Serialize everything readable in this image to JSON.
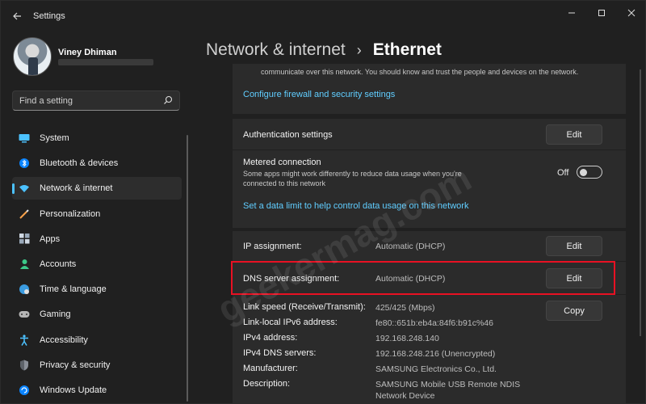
{
  "app": {
    "title": "Settings"
  },
  "user": {
    "name": "Viney Dhiman"
  },
  "search": {
    "placeholder": "Find a setting"
  },
  "nav": {
    "items": [
      {
        "label": "System",
        "icon": "system-icon"
      },
      {
        "label": "Bluetooth & devices",
        "icon": "bluetooth-icon"
      },
      {
        "label": "Network & internet",
        "icon": "network-icon",
        "active": true
      },
      {
        "label": "Personalization",
        "icon": "personalization-icon"
      },
      {
        "label": "Apps",
        "icon": "apps-icon"
      },
      {
        "label": "Accounts",
        "icon": "accounts-icon"
      },
      {
        "label": "Time & language",
        "icon": "time-language-icon"
      },
      {
        "label": "Gaming",
        "icon": "gaming-icon"
      },
      {
        "label": "Accessibility",
        "icon": "accessibility-icon"
      },
      {
        "label": "Privacy & security",
        "icon": "privacy-icon"
      },
      {
        "label": "Windows Update",
        "icon": "windows-update-icon"
      }
    ]
  },
  "header": {
    "parent": "Network & internet",
    "separator": "›",
    "current": "Ethernet"
  },
  "content": {
    "top_text": "communicate over this network. You should know and trust the people and devices on the network.",
    "firewall_link": "Configure firewall and security settings",
    "auth": {
      "label": "Authentication settings",
      "button": "Edit"
    },
    "metered": {
      "label": "Metered connection",
      "description_line1": "Some apps might work differently to reduce data usage when you're",
      "description_line2": "connected to this network",
      "toggle_state": "Off",
      "data_limit_link": "Set a data limit to help control data usage on this network"
    },
    "ip": {
      "label": "IP assignment:",
      "value": "Automatic (DHCP)",
      "button": "Edit"
    },
    "dns": {
      "label": "DNS server assignment:",
      "value": "Automatic (DHCP)",
      "button": "Edit"
    },
    "details": {
      "copy_button": "Copy",
      "rows": [
        {
          "label": "Link speed (Receive/Transmit):",
          "value": "425/425 (Mbps)"
        },
        {
          "label": "Link-local IPv6 address:",
          "value": "fe80::651b:eb4a:84f6:b91c%46"
        },
        {
          "label": "IPv4 address:",
          "value": "192.168.248.140"
        },
        {
          "label": "IPv4 DNS servers:",
          "value": "192.168.248.216 (Unencrypted)"
        },
        {
          "label": "Manufacturer:",
          "value": "SAMSUNG Electronics Co., Ltd."
        },
        {
          "label": "Description:",
          "value": "SAMSUNG Mobile USB Remote NDIS"
        },
        {
          "label": "",
          "value": "Network Device"
        }
      ]
    }
  },
  "watermark": "geekermag.com",
  "colors": {
    "background": "#202020",
    "panel": "#2b2b2b",
    "link": "#60cdff",
    "accent": "#4cc2ff",
    "highlight": "#e81123"
  }
}
